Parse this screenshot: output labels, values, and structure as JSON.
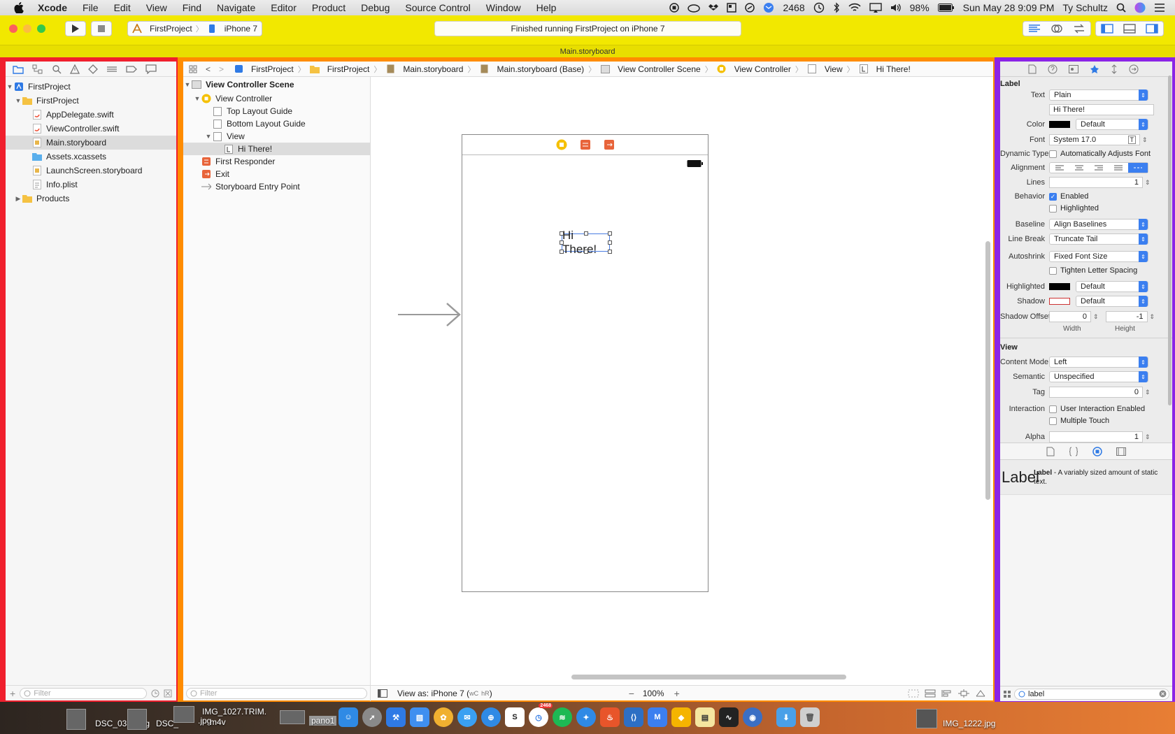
{
  "menubar": {
    "app": "Xcode",
    "items": [
      "File",
      "Edit",
      "View",
      "Find",
      "Navigate",
      "Editor",
      "Product",
      "Debug",
      "Source Control",
      "Window",
      "Help"
    ],
    "badge_count": "2468",
    "battery": "98%",
    "clock": "Sun May 28  9:09 PM",
    "user": "Ty Schultz"
  },
  "toolbar": {
    "scheme_project": "FirstProject",
    "scheme_device": "iPhone 7",
    "activity": "Finished running FirstProject on iPhone 7",
    "tab_title": "Main.storyboard"
  },
  "navigator": {
    "items": [
      {
        "label": "FirstProject",
        "icon": "xcode-project-icon",
        "disclosure": "▼"
      },
      {
        "label": "FirstProject",
        "icon": "folder-icon",
        "disclosure": "▼"
      },
      {
        "label": "AppDelegate.swift",
        "icon": "swift-file-icon"
      },
      {
        "label": "ViewController.swift",
        "icon": "swift-file-icon"
      },
      {
        "label": "Main.storyboard",
        "icon": "storyboard-file-icon"
      },
      {
        "label": "Assets.xcassets",
        "icon": "assets-folder-icon"
      },
      {
        "label": "LaunchScreen.storyboard",
        "icon": "storyboard-file-icon"
      },
      {
        "label": "Info.plist",
        "icon": "plist-file-icon"
      },
      {
        "label": "Products",
        "icon": "folder-icon",
        "disclosure": "▶"
      }
    ],
    "filter_placeholder": "Filter"
  },
  "jumpbar": {
    "crumbs": [
      "FirstProject",
      "FirstProject",
      "Main.storyboard",
      "Main.storyboard (Base)",
      "View Controller Scene",
      "View Controller",
      "View",
      "Hi There!"
    ]
  },
  "outline": {
    "scene_title": "View Controller Scene",
    "items": [
      {
        "label": "View Controller"
      },
      {
        "label": "Top Layout Guide"
      },
      {
        "label": "Bottom Layout Guide"
      },
      {
        "label": "View"
      },
      {
        "label": "Hi There!"
      },
      {
        "label": "First Responder"
      },
      {
        "label": "Exit"
      },
      {
        "label": "Storyboard Entry Point"
      }
    ],
    "filter_placeholder": "Filter"
  },
  "canvas": {
    "label_text": "Hi There!",
    "view_as": "View as: iPhone 7 (",
    "size_class_w": "wC",
    "size_class_h": "hR",
    "view_as_close": ")",
    "zoom": "100%"
  },
  "inspector": {
    "label_section": "Label",
    "text_label": "Text",
    "text_type": "Plain",
    "text_value": "Hi There!",
    "color_label": "Color",
    "color_value": "Default",
    "font_label": "Font",
    "font_value": "System 17.0",
    "dynamic_type_label": "Dynamic Type",
    "dynamic_type_value": "Automatically Adjusts Font",
    "alignment_label": "Alignment",
    "lines_label": "Lines",
    "lines_value": "1",
    "behavior_label": "Behavior",
    "enabled": "Enabled",
    "highlighted_check": "Highlighted",
    "baseline_label": "Baseline",
    "baseline_value": "Align Baselines",
    "line_break_label": "Line Break",
    "line_break_value": "Truncate Tail",
    "autoshrink_label": "Autoshrink",
    "autoshrink_value": "Fixed Font Size",
    "tighten": "Tighten Letter Spacing",
    "highlighted_label": "Highlighted",
    "highlighted_value": "Default",
    "shadow_label": "Shadow",
    "shadow_value": "Default",
    "shadow_offset_label": "Shadow Offset",
    "shadow_width": "0",
    "shadow_height": "-1",
    "width_caption": "Width",
    "height_caption": "Height",
    "view_section": "View",
    "content_mode_label": "Content Mode",
    "content_mode_value": "Left",
    "semantic_label": "Semantic",
    "semantic_value": "Unspecified",
    "tag_label": "Tag",
    "tag_value": "0",
    "interaction_label": "Interaction",
    "user_interaction": "User Interaction Enabled",
    "multiple_touch": "Multiple Touch",
    "alpha_label": "Alpha",
    "alpha_value": "1"
  },
  "library": {
    "item_icon_text": "Label",
    "item_title": "Label",
    "item_desc": " - A variably sized amount of static text.",
    "search_value": "label"
  },
  "dock": {
    "left_labels": [
      "DSC_0385.jpg",
      "DSC_",
      ".jpg",
      "IMG_1027.TRIM.",
      "m4v",
      "pano1"
    ],
    "right_label": "IMG_1222.jpg",
    "badge": "2468"
  },
  "colors": {
    "toolbar": "#f2e800",
    "frame_left": "#f01f2d",
    "frame_center": "#ff8c00",
    "frame_right": "#8b24e6",
    "accent": "#3b7ff0"
  }
}
